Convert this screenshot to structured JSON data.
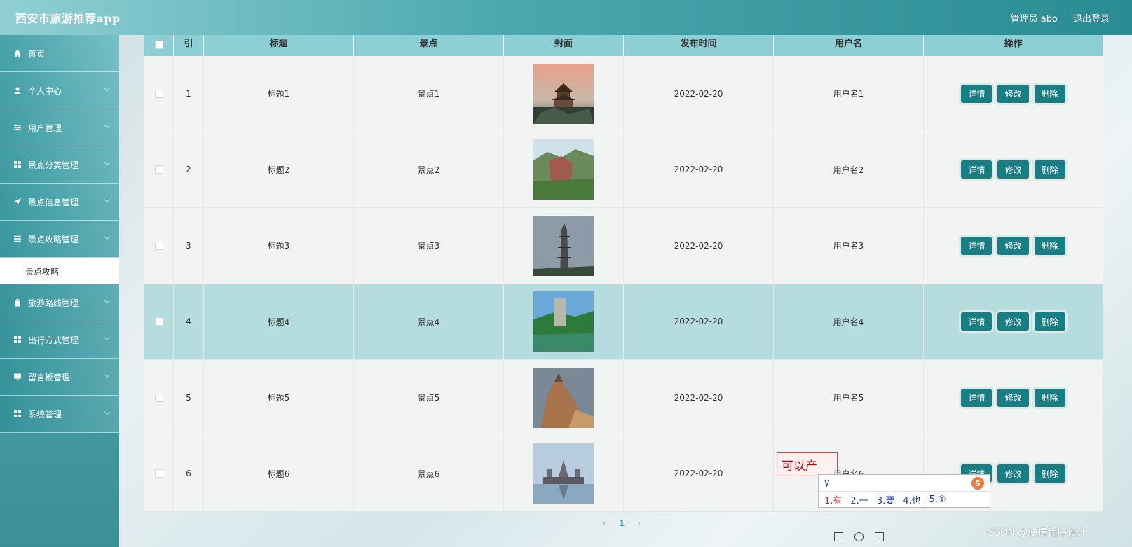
{
  "header": {
    "title": "西安市旅游推荐app",
    "user": "管理员 abo",
    "logout": "退出登录"
  },
  "sidebar": {
    "items": [
      {
        "label": "首页",
        "icon": "home-icon"
      },
      {
        "label": "个人中心",
        "icon": "user-icon"
      },
      {
        "label": "用户管理",
        "icon": "sliders-icon"
      },
      {
        "label": "景点分类管理",
        "icon": "grid-icon"
      },
      {
        "label": "景点信息管理",
        "icon": "send-icon"
      },
      {
        "label": "景点攻略管理",
        "icon": "list-icon"
      },
      {
        "label": "旅游路线管理",
        "icon": "clipboard-icon"
      },
      {
        "label": "出行方式管理",
        "icon": "grid-icon"
      },
      {
        "label": "留言板管理",
        "icon": "monitor-icon"
      },
      {
        "label": "系统管理",
        "icon": "grid-icon"
      }
    ],
    "active_sub": "景点攻略"
  },
  "table": {
    "columns": [
      "",
      "引",
      "标题",
      "景点",
      "封面",
      "发布时间",
      "用户名",
      "操作"
    ],
    "rows": [
      {
        "idx": "1",
        "title": "标题1",
        "spot": "景点1",
        "date": "2022-02-20",
        "user": "用户名1"
      },
      {
        "idx": "2",
        "title": "标题2",
        "spot": "景点2",
        "date": "2022-02-20",
        "user": "用户名2"
      },
      {
        "idx": "3",
        "title": "标题3",
        "spot": "景点3",
        "date": "2022-02-20",
        "user": "用户名3"
      },
      {
        "idx": "4",
        "title": "标题4",
        "spot": "景点4",
        "date": "2022-02-20",
        "user": "用户名4"
      },
      {
        "idx": "5",
        "title": "标题5",
        "spot": "景点5",
        "date": "2022-02-20",
        "user": "用户名5"
      },
      {
        "idx": "6",
        "title": "标题6",
        "spot": "景点6",
        "date": "2022-02-20",
        "user": "用户名6"
      }
    ],
    "actions": {
      "detail": "详情",
      "edit": "修改",
      "delete": "删除"
    }
  },
  "pager": {
    "prev": "‹",
    "current": "1",
    "next": "›"
  },
  "ime": {
    "hint": "可以产",
    "input": "y",
    "candidates": [
      "1.有",
      "2.一",
      "3.要",
      "4.也",
      "5.①"
    ],
    "logo": "S"
  },
  "watermark": "CSDN @便捷程序设计"
}
